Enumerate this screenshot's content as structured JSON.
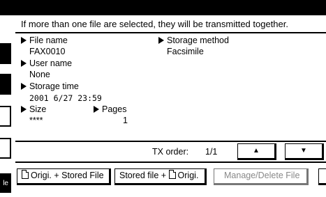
{
  "hint": "If more than one file are selected, they will be transmitted together.",
  "file": {
    "file_name_label": "File name",
    "file_name_value": "FAX0010",
    "storage_method_label": "Storage method",
    "storage_method_value": "Facsimile",
    "user_name_label": "User name",
    "user_name_value": "None",
    "storage_time_label": "Storage time",
    "storage_time_value": "2001  6/27 23:59",
    "size_label": "Size",
    "size_value": "****",
    "pages_label": "Pages",
    "pages_value": "1"
  },
  "status": {
    "tx_order_label": "TX order:",
    "tx_order_value": "1/1",
    "scroll_up_icon": "triangle-up",
    "scroll_down_icon": "triangle-down"
  },
  "left_tab_text": "le",
  "buttons": {
    "origi_stored_file": "Origi. + Stored File",
    "stored_file_origi": "Stored file +",
    "stored_file_origi_suffix": "Origi.",
    "manage_delete_file": "Manage/Delete File"
  }
}
